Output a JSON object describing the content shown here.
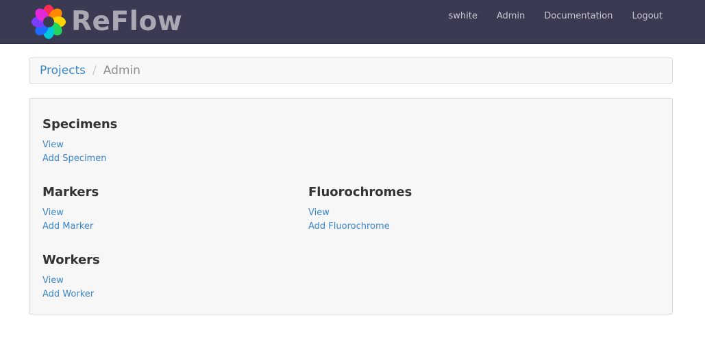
{
  "app": {
    "brand": "ReFlow",
    "logo_icon": "flower-logo-icon"
  },
  "nav": {
    "items": [
      {
        "label": "swhite"
      },
      {
        "label": "Admin"
      },
      {
        "label": "Documentation"
      },
      {
        "label": "Logout"
      }
    ]
  },
  "breadcrumb": {
    "items": [
      {
        "label": "Projects"
      },
      {
        "label": "Admin"
      }
    ],
    "separator": "/"
  },
  "sections": {
    "specimens": {
      "title": "Specimens",
      "view": "View",
      "add": "Add Specimen"
    },
    "markers": {
      "title": "Markers",
      "view": "View",
      "add": "Add Marker"
    },
    "fluorochromes": {
      "title": "Fluorochromes",
      "view": "View",
      "add": "Add Fluorochrome"
    },
    "workers": {
      "title": "Workers",
      "view": "View",
      "add": "Add Worker"
    }
  },
  "colors": {
    "navbar_bg": "#3a3b52",
    "link": "#3a86c8"
  }
}
